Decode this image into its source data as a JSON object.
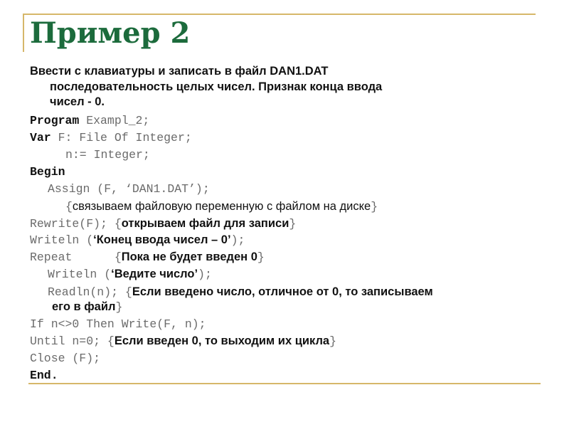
{
  "slide": {
    "title": "Пример 2",
    "accent_color": "#1c6b3c",
    "frame_color": "#d6b76a",
    "task": {
      "line1": "Ввести с клавиатуры и записать в файл DAN1.DAT",
      "line2": "последовательность целых чисел. Признак конца ввода",
      "line3": "чисел - 0."
    },
    "code": {
      "l_program_kw": "Program",
      "l_program_rest": " Exampl_2;",
      "l_var_kw": "Var",
      "l_var_rest": " F: File Of Integer;",
      "l_n": "n:= Integer;",
      "l_begin": "Begin",
      "l_assign": "Assign (F, ‘DAN1.DAT’);",
      "l_assign_comment": "связываем файловую переменную с файлом на диске",
      "l_rewrite": "Rewrite(F); ",
      "l_rewrite_comment": "открываем файл для записи",
      "l_writeln1_code": "Writeln (",
      "l_writeln1_str": "‘Конец ввода чисел – 0’",
      "l_writeln1_end": ");",
      "l_repeat": "Repeat      ",
      "l_repeat_comment": "Пока не будет введен 0",
      "l_writeln2_code": "Writeln (",
      "l_writeln2_str": "‘Ведите число’",
      "l_writeln2_end": ");",
      "l_readln": "Readln(n); ",
      "l_readln_comment1": "Если введено число, отличное от 0, то записываем",
      "l_readln_comment2": "его в файл",
      "l_if": "If n<>0 Then Write(F, n);",
      "l_until": "Until n=0; ",
      "l_until_comment": "Если введен 0, то выходим их цикла",
      "l_close": "Close (F);",
      "l_end": "End.",
      "brace_open": "{",
      "brace_close": "}"
    }
  }
}
